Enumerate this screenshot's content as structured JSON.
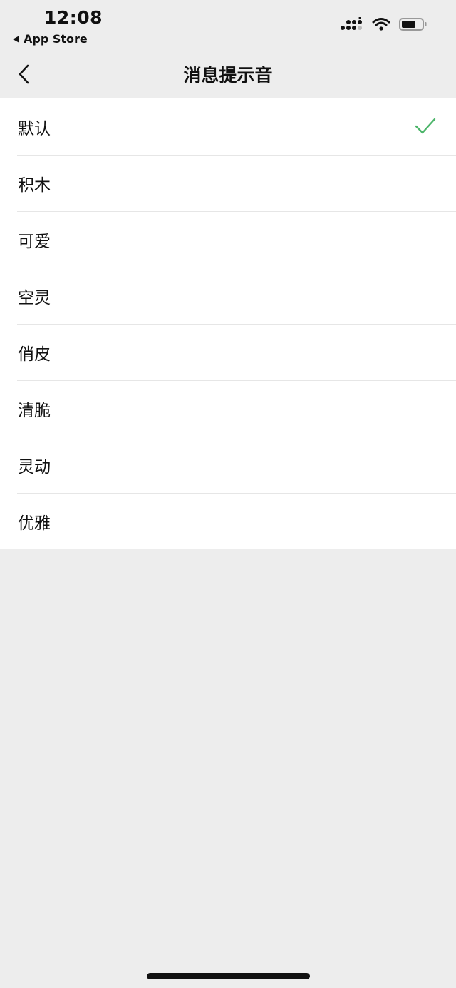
{
  "status_bar": {
    "time": "12:08",
    "back_app_label": "App Store",
    "icons": [
      "signal-icon",
      "wifi-icon",
      "battery-icon"
    ]
  },
  "nav": {
    "title": "消息提示音",
    "back_icon": "chevron-left-icon"
  },
  "sounds": {
    "selected": "默认",
    "accent_color": "#4cb56a",
    "items": [
      {
        "label": "默认"
      },
      {
        "label": "积木"
      },
      {
        "label": "可爱"
      },
      {
        "label": "空灵"
      },
      {
        "label": "俏皮"
      },
      {
        "label": "清脆"
      },
      {
        "label": "灵动"
      },
      {
        "label": "优雅"
      }
    ]
  }
}
